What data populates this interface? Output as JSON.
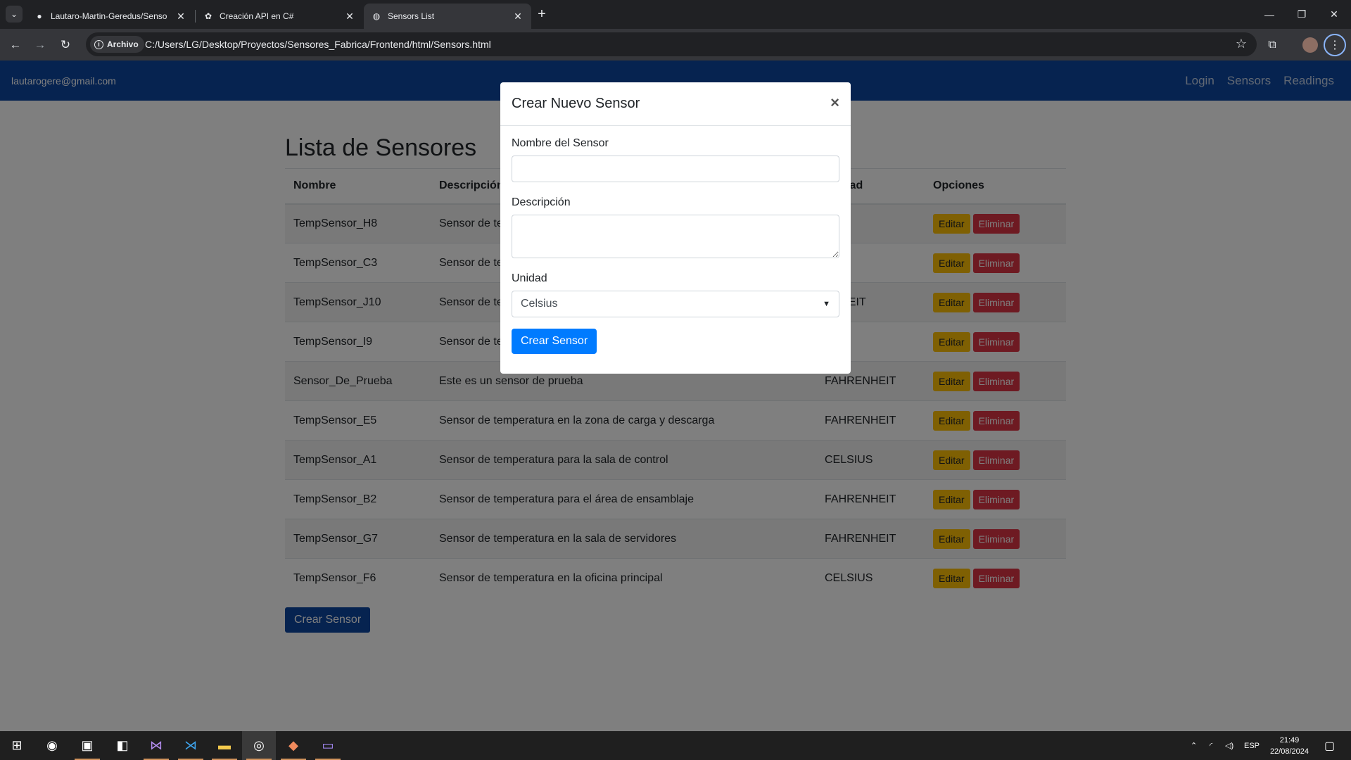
{
  "browser": {
    "tabs": [
      {
        "title": "Lautaro-Martin-Geredus/Senso",
        "favicon": "github-icon"
      },
      {
        "title": "Creación API en C#",
        "favicon": "openai-icon"
      },
      {
        "title": "Sensors List",
        "favicon": "globe-icon",
        "active": true
      }
    ],
    "chip_label": "Archivo",
    "url": "C:/Users/LG/Desktop/Proyectos/Sensores_Fabrica/Frontend/html/Sensors.html"
  },
  "site": {
    "email": "lautarogere@gmail.com",
    "links": [
      "Login",
      "Sensors",
      "Readings"
    ]
  },
  "main": {
    "title": "Lista de Sensores",
    "columns": [
      "Nombre",
      "Descripción",
      "Unidad",
      "Opciones"
    ],
    "column_headers_visible": {
      "unit_partial": "ad"
    },
    "rows": [
      {
        "name": "TempSensor_H8",
        "desc": "Sensor de te",
        "unit": "US"
      },
      {
        "name": "TempSensor_C3",
        "desc": "Sensor de te",
        "unit": "US"
      },
      {
        "name": "TempSensor_J10",
        "desc": "Sensor de te",
        "unit": "ENHEIT"
      },
      {
        "name": "TempSensor_I9",
        "desc": "Sensor de te",
        "unit": "US"
      },
      {
        "name": "Sensor_De_Prueba",
        "desc": "Este es un sensor de prueba",
        "unit": "FAHRENHEIT"
      },
      {
        "name": "TempSensor_E5",
        "desc": "Sensor de temperatura en la zona de carga y descarga",
        "unit": "FAHRENHEIT"
      },
      {
        "name": "TempSensor_A1",
        "desc": "Sensor de temperatura para la sala de control",
        "unit": "CELSIUS"
      },
      {
        "name": "TempSensor_B2",
        "desc": "Sensor de temperatura para el área de ensamblaje",
        "unit": "FAHRENHEIT"
      },
      {
        "name": "TempSensor_G7",
        "desc": "Sensor de temperatura en la sala de servidores",
        "unit": "FAHRENHEIT"
      },
      {
        "name": "TempSensor_F6",
        "desc": "Sensor de temperatura en la oficina principal",
        "unit": "CELSIUS"
      }
    ],
    "edit_label": "Editar",
    "delete_label": "Eliminar",
    "create_label": "Crear Sensor"
  },
  "modal": {
    "title": "Crear Nuevo Sensor",
    "close_glyph": "×",
    "name_label": "Nombre del Sensor",
    "name_value": "",
    "desc_label": "Descripción",
    "desc_value": "",
    "unit_label": "Unidad",
    "unit_selected": "Celsius",
    "submit_label": "Crear Sensor"
  },
  "taskbar": {
    "lang": "ESP",
    "time": "21:49",
    "date": "22/08/2024"
  },
  "colors": {
    "site_nav": "#0d47a1",
    "warning": "#ffc107",
    "danger": "#dc3545",
    "primary": "#007bff"
  }
}
